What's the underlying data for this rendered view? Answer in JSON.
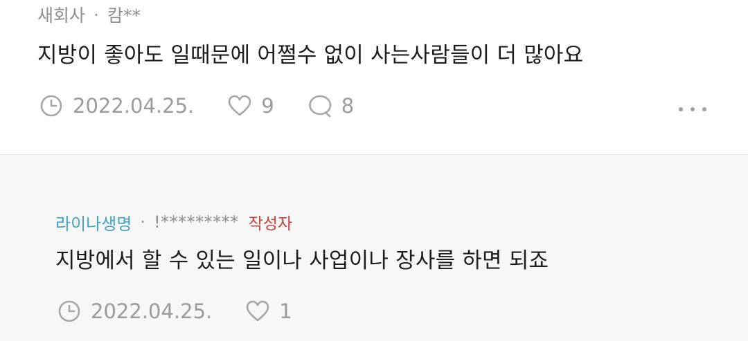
{
  "comments": [
    {
      "author": "새회사",
      "separator": "·",
      "masked_name": "캄**",
      "text": "지방이 좋아도 일때문에 어쩔수 없이 사는사람들이 더 많아요",
      "date": "2022.04.25.",
      "likes": "9",
      "replies": "8",
      "icons": [
        "clock-icon",
        "heart-icon",
        "speech-bubble-icon",
        "more-options-icon"
      ]
    },
    {
      "author": "라이나생명",
      "separator": "·",
      "masked_name": "!*********",
      "badge": "작성자",
      "text": "지방에서 할 수 있는 일이나 사업이나 장사를 하면 되죠",
      "date": "2022.04.25.",
      "likes": "1",
      "icons": [
        "clock-icon",
        "heart-icon"
      ]
    }
  ],
  "colors": {
    "author_highlight": "#3fa3c9",
    "writer_badge": "#c9403e",
    "meta_grey": "#9b9b9b",
    "reply_background": "#f7f7f7"
  }
}
